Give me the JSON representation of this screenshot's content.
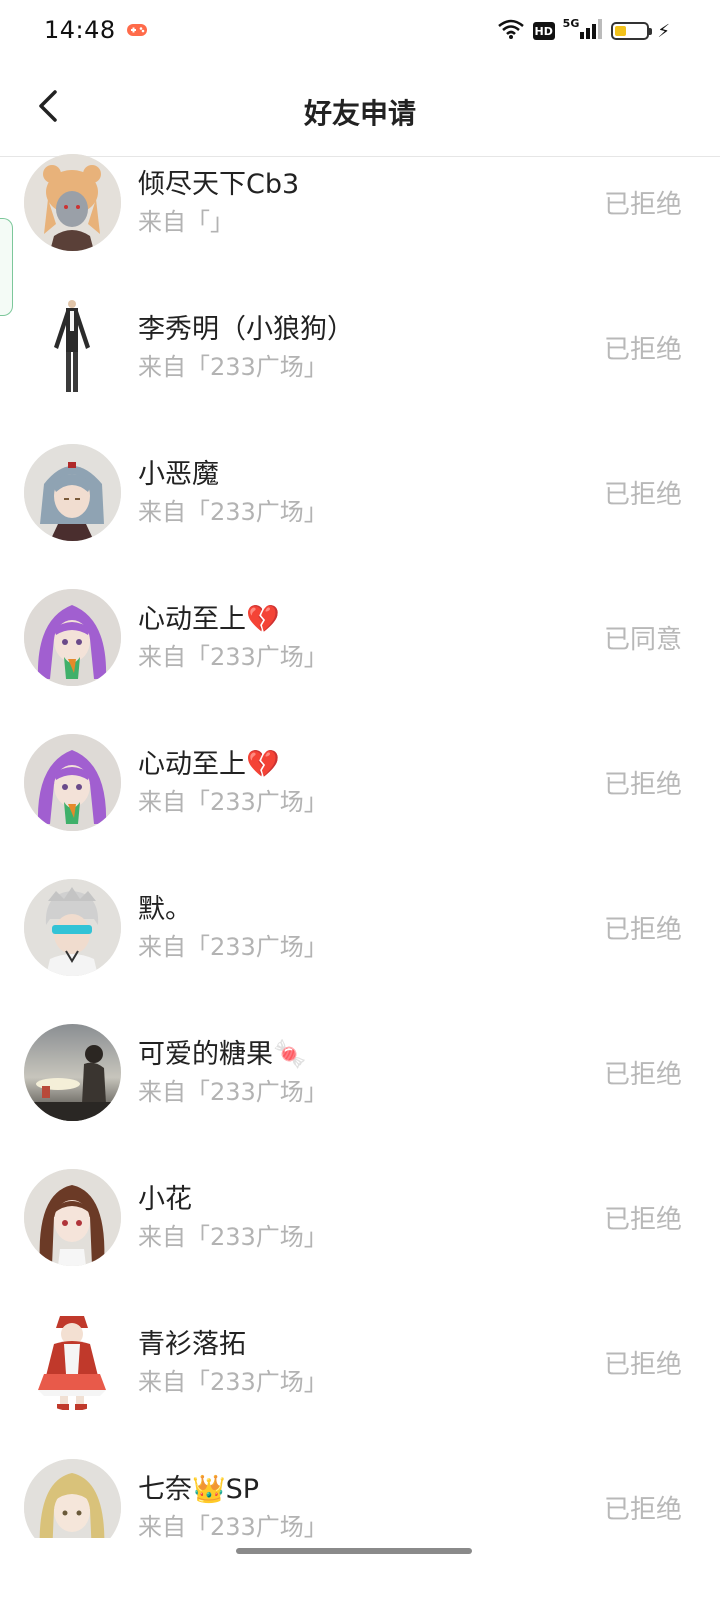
{
  "status_bar": {
    "time": "14:48",
    "network": "5G",
    "hd": "HD",
    "battery_level": 0.35,
    "icons": [
      "game-icon",
      "wifi-icon",
      "hd-icon",
      "signal-icon",
      "battery-icon",
      "charging-icon"
    ]
  },
  "header": {
    "title": "好友申请",
    "back_icon": "chevron-left-icon"
  },
  "requests": [
    {
      "name": "倾尽天下Cb3",
      "source": "来自「」",
      "status": "已拒绝"
    },
    {
      "name": "李秀明（小狼狗）",
      "source": "来自「233广场」",
      "status": "已拒绝"
    },
    {
      "name": "小恶魔",
      "source": "来自「233广场」",
      "status": "已拒绝"
    },
    {
      "name": "心动至上💔",
      "source": "来自「233广场」",
      "status": "已同意"
    },
    {
      "name": "心动至上💔",
      "source": "来自「233广场」",
      "status": "已拒绝"
    },
    {
      "name": "默。",
      "source": "来自「233广场」",
      "status": "已拒绝"
    },
    {
      "name": "可爱的糖果🍬",
      "source": "来自「233广场」",
      "status": "已拒绝"
    },
    {
      "name": "小花",
      "source": "来自「233广场」",
      "status": "已拒绝"
    },
    {
      "name": "青衫落拓",
      "source": "来自「233广场」",
      "status": "已拒绝"
    },
    {
      "name": "七奈👑SP",
      "source": "来自「233广场」",
      "status": "已拒绝"
    }
  ],
  "colors": {
    "accent_green": "#7cc79a",
    "muted_text": "#b3b3b3",
    "battery": "#f2c21b"
  }
}
